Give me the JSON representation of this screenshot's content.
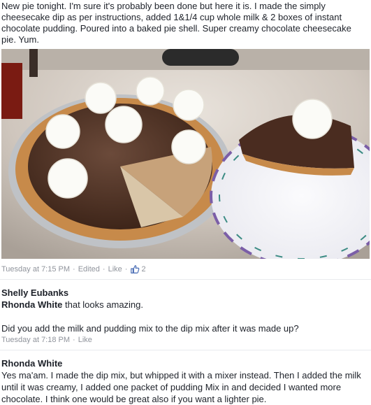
{
  "post": {
    "text": "New pie tonight. I'm sure it's probably been done but here it is. I made the simply cheesecake dip as per instructions, added 1&1/4 cup whole milk & 2 boxes of instant chocolate pudding. Poured into a baked pie shell. Super creamy chocolate cheesecake pie. Yum.",
    "timestamp": "Tuesday at 7:15 PM",
    "edited_label": "Edited",
    "like_label": "Like",
    "like_count": "2",
    "separator": "·"
  },
  "comments": [
    {
      "author": "Shelly Eubanks",
      "mention": "Rhonda White",
      "text_1": " that looks amazing.",
      "text_2": "Did you add the milk and pudding mix to the dip mix after it was made up?",
      "timestamp": "Tuesday at 7:18 PM",
      "like_label": "Like"
    },
    {
      "author": "Rhonda White",
      "text": "Yes ma'am. I made the dip mix, but whipped it with a mixer instead. Then I added the milk until it was creamy, I added one packet of pudding Mix in and decided I wanted more chocolate. I think one would be great also if you want a lighter pie."
    }
  ],
  "colors": {
    "text": "#1d2129",
    "meta": "#90949c",
    "link_blue": "#4267b2",
    "divider": "#e9ebee"
  },
  "icons": {
    "like": "thumbs-up-icon"
  }
}
